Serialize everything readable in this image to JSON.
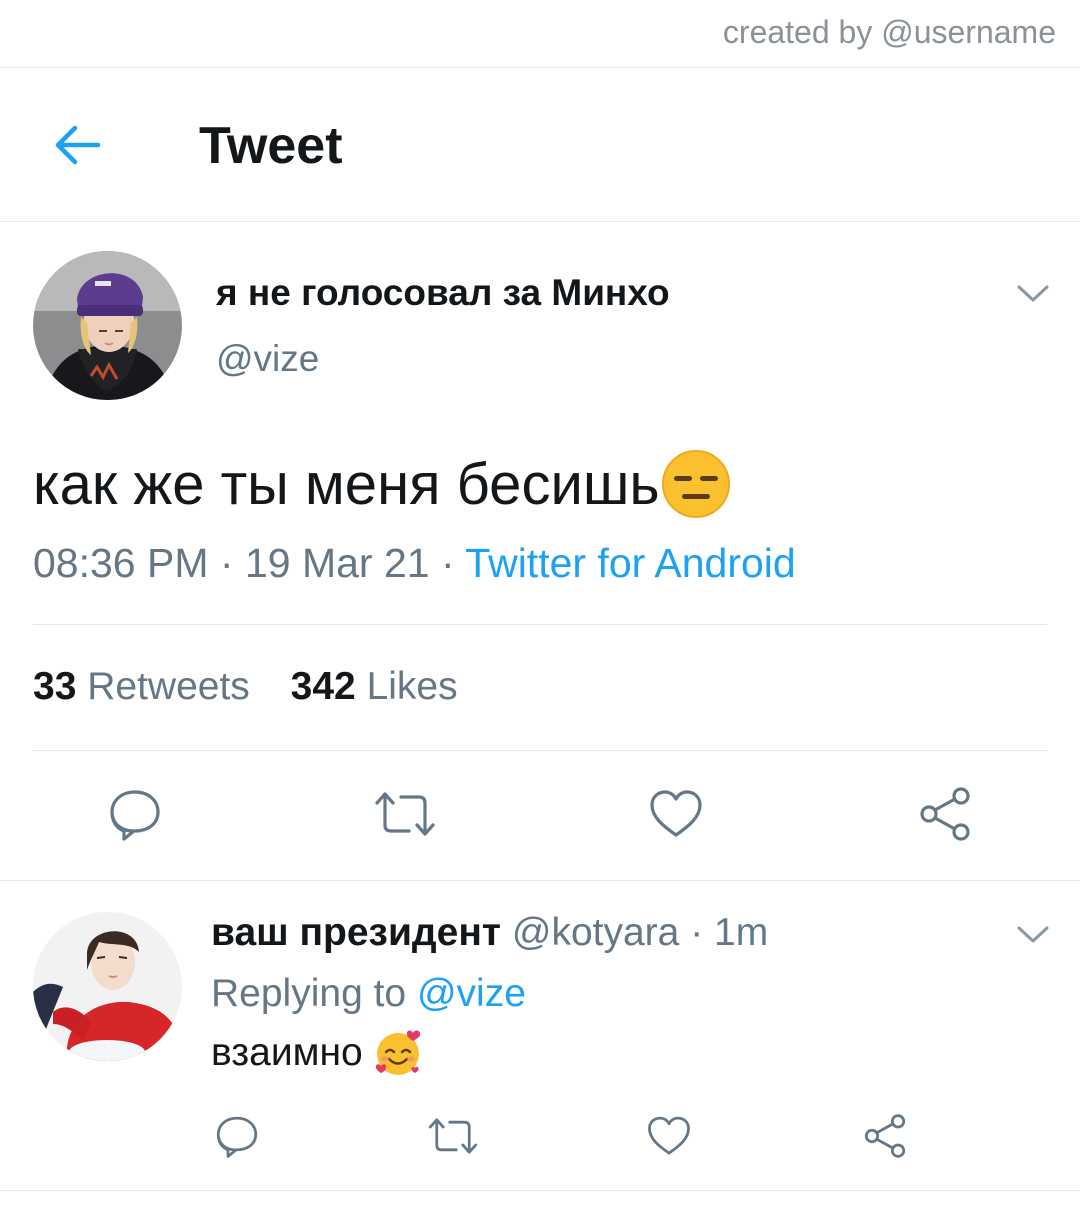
{
  "credit": {
    "text": "created by @username"
  },
  "header": {
    "title": "Tweet",
    "back_icon": "arrow-left-icon"
  },
  "tweet": {
    "author_name": "я не голосовал за Минхо",
    "author_handle": "@vize",
    "text": "как же ты меня бесишь",
    "emoji": "expressionless-face-emoji",
    "time": "08:36 PM",
    "separator": "·",
    "date": "19 Mar 21",
    "source": "Twitter for Android",
    "retweets_count": "33",
    "retweets_label": "Retweets",
    "likes_count": "342",
    "likes_label": "Likes",
    "actions": [
      "reply-icon",
      "retweet-icon",
      "like-icon",
      "share-icon"
    ]
  },
  "reply": {
    "author_name": "ваш президент",
    "author_handle": "@kotyara",
    "separator": "·",
    "time": "1m",
    "replying_to_label": "Replying to",
    "replying_to_handle": "@vize",
    "text": "взаимно",
    "emoji": "smiling-face-with-hearts-emoji",
    "actions": [
      "reply-icon",
      "retweet-icon",
      "like-icon",
      "share-icon"
    ]
  },
  "colors": {
    "accent": "#1da1f2",
    "secondary_text": "#657786",
    "primary_text": "#14171a",
    "divider": "#e1e8ed"
  }
}
